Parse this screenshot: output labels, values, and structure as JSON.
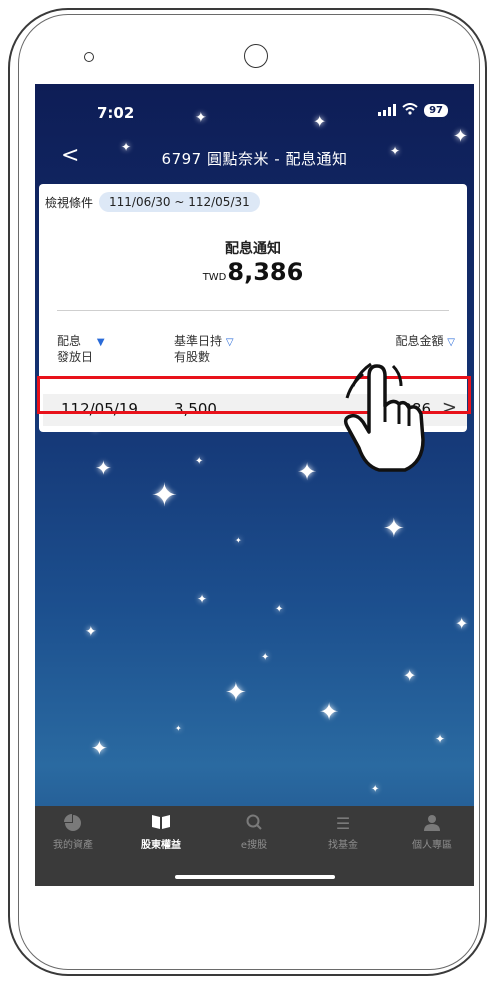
{
  "status_bar": {
    "time": "7:02",
    "battery": "97"
  },
  "nav": {
    "back_symbol": "<",
    "title": "6797 圓點奈米 - 配息通知"
  },
  "filter": {
    "label": "檢視條件",
    "range": "111/06/30 ~ 112/05/31"
  },
  "summary": {
    "title": "配息通知",
    "currency": "TWD",
    "amount": "8,386"
  },
  "table": {
    "columns": [
      {
        "line1": "配息",
        "line2": "發放日",
        "sort": "▼"
      },
      {
        "line1": "基準日持",
        "line2": "有股數",
        "sort": "▽"
      },
      {
        "line1": "配息金額",
        "line2": "",
        "sort": "▽"
      }
    ],
    "rows": [
      {
        "date": "112/05/19",
        "shares": "3,500",
        "amount": "8,386"
      }
    ]
  },
  "tabs": [
    {
      "label": "我的資產",
      "icon": "pie-chart-icon",
      "active": false
    },
    {
      "label": "股東權益",
      "icon": "book-icon",
      "active": true
    },
    {
      "label": "e搜股",
      "icon": "search-icon",
      "active": false
    },
    {
      "label": "找基金",
      "icon": "list-icon",
      "active": false
    },
    {
      "label": "個人專區",
      "icon": "person-icon",
      "active": false
    }
  ],
  "colors": {
    "highlight": "#e8111a",
    "chip_bg": "#dde8f6",
    "tab_bar": "#3a3a3a",
    "sort_arrow": "#2a6bd8"
  }
}
